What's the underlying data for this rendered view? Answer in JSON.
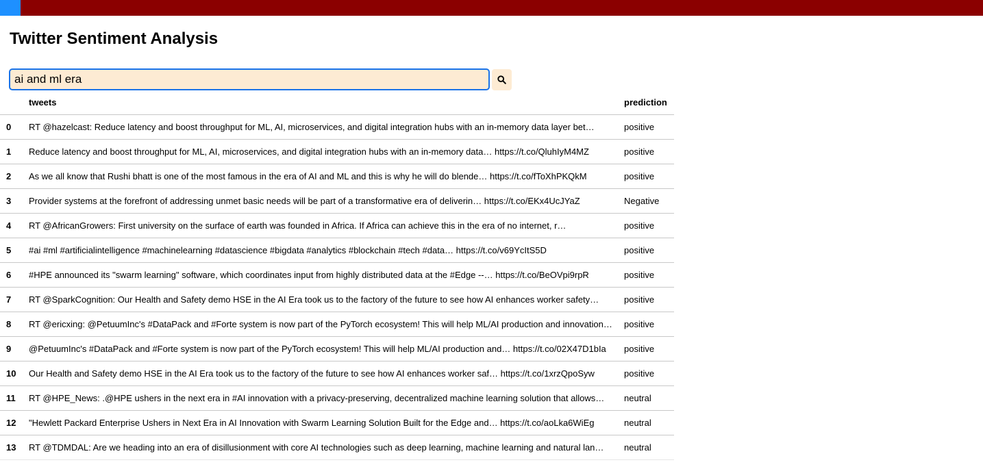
{
  "colors": {
    "topbar": "#8b0000",
    "topbar_accent": "#1e90ff",
    "input_background": "#fdebd3",
    "input_border": "#1a73e8"
  },
  "header": {
    "title": "Twitter Sentiment Analysis"
  },
  "search": {
    "value": "ai and ml era",
    "button_icon": "search-icon"
  },
  "table": {
    "columns": {
      "index": "",
      "tweets": "tweets",
      "prediction": "prediction"
    },
    "rows": [
      {
        "index": "0",
        "tweet": "RT @hazelcast: Reduce latency and boost throughput for ML, AI, microservices, and digital integration hubs with an in-memory data layer bet…",
        "prediction": "positive"
      },
      {
        "index": "1",
        "tweet": "Reduce latency and boost throughput for ML, AI, microservices, and digital integration hubs with an in-memory data… https://t.co/QluhIyM4MZ",
        "prediction": "positive"
      },
      {
        "index": "2",
        "tweet": "As we all know that Rushi bhatt is one of the most famous in the era of AI and ML and this is why he will do blende… https://t.co/fToXhPKQkM",
        "prediction": "positive"
      },
      {
        "index": "3",
        "tweet": "Provider systems at the forefront of addressing unmet basic needs will be part of a transformative era of deliverin… https://t.co/EKx4UcJYaZ",
        "prediction": "Negative"
      },
      {
        "index": "4",
        "tweet": "RT @AfricanGrowers: First university on the surface of earth was founded in Africa. If Africa can achieve this in the era of no internet, r…",
        "prediction": "positive"
      },
      {
        "index": "5",
        "tweet": "#ai #ml #artificialintelligence #machinelearning #datascience #bigdata #analytics #blockchain #tech #data… https://t.co/v69YcItS5D",
        "prediction": "positive"
      },
      {
        "index": "6",
        "tweet": "#HPE announced its \"swarm learning\" software, which coordinates input from highly distributed data at the #Edge --… https://t.co/BeOVpi9rpR",
        "prediction": "positive"
      },
      {
        "index": "7",
        "tweet": "RT @SparkCognition: Our Health and Safety demo HSE in the AI Era took us to the factory of the future to see how AI enhances worker safety…",
        "prediction": "positive"
      },
      {
        "index": "8",
        "tweet": "RT @ericxing: @PetuumInc's #DataPack and #Forte system is now part of the PyTorch ecosystem! This will help ML/AI production and innovation…",
        "prediction": "positive"
      },
      {
        "index": "9",
        "tweet": "@PetuumInc's #DataPack and #Forte system is now part of the PyTorch ecosystem! This will help ML/AI production and… https://t.co/02X47D1bIa",
        "prediction": "positive"
      },
      {
        "index": "10",
        "tweet": "Our Health and Safety demo HSE in the AI Era took us to the factory of the future to see how AI enhances worker saf… https://t.co/1xrzQpoSyw",
        "prediction": "positive"
      },
      {
        "index": "11",
        "tweet": "RT @HPE_News: .@HPE ushers in the next era in #AI innovation with a privacy-preserving, decentralized machine learning solution that allows…",
        "prediction": "neutral"
      },
      {
        "index": "12",
        "tweet": "\"Hewlett Packard Enterprise Ushers in Next Era in AI Innovation with Swarm Learning Solution Built for the Edge and… https://t.co/aoLka6WiEg",
        "prediction": "neutral"
      },
      {
        "index": "13",
        "tweet": "RT @TDMDAL: Are we heading into an era of disillusionment with core AI technologies such as deep learning, machine learning and natural lan…",
        "prediction": "neutral"
      }
    ]
  }
}
